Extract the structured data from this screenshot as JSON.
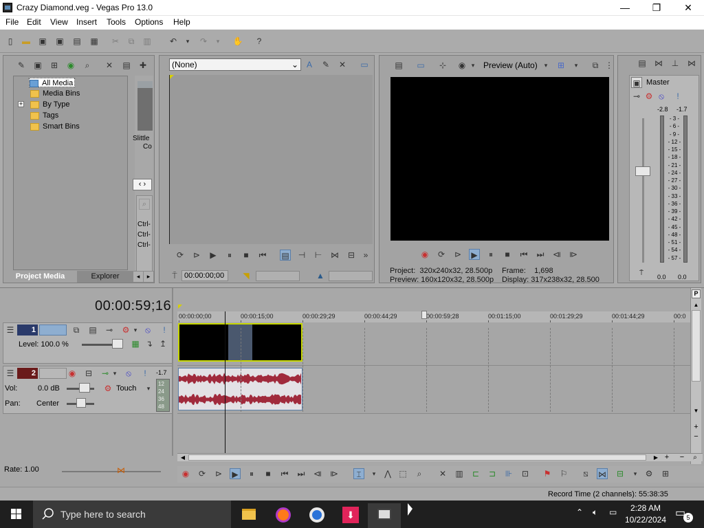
{
  "window": {
    "title": "Crazy Diamond.veg - Vegas Pro 13.0",
    "minimize_icon": "—",
    "maximize_icon": "❐",
    "close_icon": "✕"
  },
  "menu": [
    "File",
    "Edit",
    "View",
    "Insert",
    "Tools",
    "Options",
    "Help"
  ],
  "project_media": {
    "tree": [
      "All Media",
      "Media Bins",
      "By Type",
      "Tags",
      "Smart Bins"
    ],
    "expand_symbol": "+",
    "thumb_caption_1": "Slittle",
    "thumb_caption_2": "Co",
    "ctrl_labels": [
      "Ctrl-",
      "Ctrl-",
      "Ctrl-"
    ],
    "tabs": [
      "Project Media",
      "Explorer"
    ]
  },
  "trimmer": {
    "dropdown_value": "(None)",
    "timecode": "00:00:00;00"
  },
  "preview": {
    "mode_label": "Preview (Auto)",
    "project_label": "Project:",
    "project_value": "320x240x32, 28.500p",
    "preview_label": "Preview:",
    "preview_value": "160x120x32, 28.500p",
    "frame_label": "Frame:",
    "frame_value": "1,698",
    "display_label": "Display:",
    "display_value": "317x238x32, 28.500"
  },
  "master": {
    "title": "Master",
    "peak_left": "-2.8",
    "peak_right": "-1.7",
    "scale": [
      "3",
      "6",
      "9",
      "12",
      "15",
      "18",
      "21",
      "24",
      "27",
      "30",
      "33",
      "36",
      "39",
      "42",
      "45",
      "48",
      "51",
      "54",
      "57"
    ],
    "bottom_left": "0.0",
    "bottom_right": "0.0"
  },
  "timeline": {
    "cursor_time": "00:00:59;16",
    "ruler_labels": [
      "00:00:00;00",
      "00:00:15;00",
      "00:00:29;29",
      "00:00:44;29",
      "00:00:59;28",
      "00:01:15;00",
      "00:01:29;29",
      "00:01:44;29",
      "00:0"
    ],
    "track1_number": "1",
    "track1_level": "Level: 100.0 %",
    "track2_number": "2",
    "track2_vol_label": "Vol:",
    "track2_vol_value": "0.0 dB",
    "track2_pan_label": "Pan:",
    "track2_pan_value": "Center",
    "track2_touch": "Touch",
    "track2_meter_peak": "-1.7",
    "track2_meter_scale": [
      "12",
      "24",
      "36",
      "48"
    ],
    "rate": "Rate: 1.00",
    "record_time": "Record Time (2 channels): 55:38:35"
  },
  "taskbar": {
    "search_placeholder": "Type here to search",
    "time": "2:28 AM",
    "date": "10/22/2024",
    "notification_count": "5"
  },
  "colors": {
    "background": "#ababab",
    "selection": "#8eaed0",
    "track_selection": "#c8d800",
    "waveform": "#a02a3c",
    "taskbar": "#1f1f1f"
  }
}
